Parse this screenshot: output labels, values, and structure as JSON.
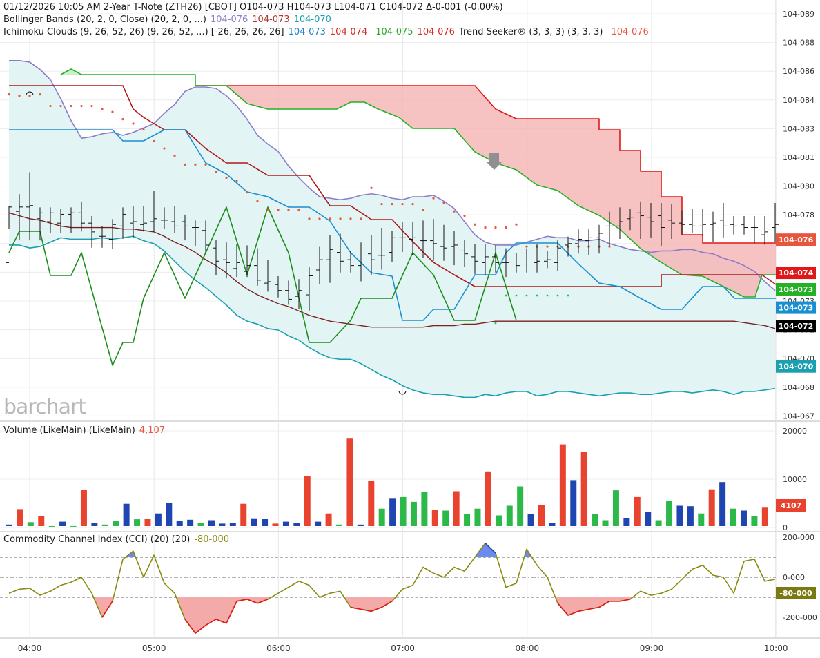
{
  "header": {
    "line1": "01/12/2026  10:05 AM  2-Year T-Note (ZTH26) [CBOT]  O104-073  H104-073  L104-071  C104-072  Δ-0-001  (-0.00%)",
    "bb_label": "Bollinger Bands (20, 2, 0, Close)  (20, 2, 0, ...)",
    "bb_upper": "104-076",
    "bb_mid": "104-073",
    "bb_lower": "104-070",
    "ichi_label": "Ichimoku Clouds (9, 26, 52, 26)  (9, 26, 52, ...)  [-26, 26, 26, 26]",
    "ichi_v1": "104-073",
    "ichi_v2": "104-074",
    "ichi_v3": "104-075",
    "ichi_v4": "104-076",
    "ts_label": "Trend Seeker® (3, 3, 3)  (3, 3, 3)",
    "ts_value": "104-076",
    "vol_label": "Volume (LikeMain)  (LikeMain)",
    "vol_value": "4,107",
    "cci_label": "Commodity Channel Index (CCI) (20)  (20)",
    "cci_value": "-80-000"
  },
  "logo": "barchart",
  "colors": {
    "up": "#2db84a",
    "down": "#e8432e",
    "neutral": "#1f46b0",
    "bb": "#8a7cc8",
    "bb_fill": "#e3f4f4",
    "cloud_bear": "#f5b3b3",
    "kijun": "#b01818",
    "tenkan": "#1a8fd0",
    "chikou": "#1a8f1a",
    "span_a": "#26b026",
    "span_b": "#e01818",
    "cci": "#8a8a10"
  },
  "chart_data": [
    {
      "type": "line",
      "title": "2-Year T-Note (ZTH26) [CBOT]",
      "y_ticks": [
        "104-089",
        "104-088",
        "104-086",
        "104-084",
        "104-083",
        "104-081",
        "104-080",
        "104-078",
        "104-077",
        "104-075",
        "104-073",
        "104-072",
        "104-070",
        "104-068",
        "104-067"
      ],
      "x_ticks": [
        "04:00",
        "05:00",
        "06:00",
        "07:00",
        "08:00",
        "09:00",
        "10:00"
      ],
      "x_range": [
        "03:45",
        "10:00"
      ],
      "price_levels": {
        "104-089": 0,
        "104-067": 22
      },
      "last_labels": [
        {
          "text": "104-076",
          "level": 12.3,
          "bg": "#e8553d"
        },
        {
          "text": "104-074",
          "level": 14.1,
          "bg": "#e01818"
        },
        {
          "text": "104-073",
          "level": 15.0,
          "bg": "#26b026"
        },
        {
          "text": "104-073",
          "level": 16.0,
          "bg": "#1a8fd0"
        },
        {
          "text": "104-072",
          "level": 17.0,
          "bg": "#000000"
        },
        {
          "text": "104-070",
          "level": 19.2,
          "bg": "#1aa0b0"
        }
      ],
      "bars": [
        [
          17.0,
          13.5,
          14.3,
          13.2
        ],
        [
          13.5,
          12.7,
          15.1,
          13.2
        ],
        [
          13.2,
          11.2,
          15.1,
          13.1
        ],
        [
          14.0,
          13.6,
          15.1,
          13.6
        ],
        [
          14.2,
          13.6,
          14.6,
          13.6
        ],
        [
          14.3,
          13.7,
          14.6,
          13.7
        ],
        [
          13.7,
          13.6,
          14.6,
          13.6
        ],
        [
          13.6,
          13.2,
          14.5,
          14.3
        ],
        [
          14.3,
          14.2,
          15.6,
          14.9
        ],
        [
          15.2,
          14.9,
          15.6,
          15.2
        ],
        [
          15.4,
          14.4,
          15.7,
          14.4
        ],
        [
          14.5,
          13.6,
          15.0,
          13.7
        ],
        [
          14.3,
          13.5,
          14.9,
          14.2
        ],
        [
          14.4,
          13.5,
          14.5,
          14.3
        ],
        [
          14.2,
          12.5,
          14.5,
          14.0
        ],
        [
          14.1,
          13.6,
          14.3,
          14.1
        ],
        [
          14.2,
          13.5,
          14.6,
          14.5
        ],
        [
          14.2,
          14.1,
          15.1,
          14.5
        ],
        [
          14.6,
          14.5,
          15.5,
          14.6
        ],
        [
          14.8,
          14.5,
          16.0,
          15.8
        ],
        [
          16.0,
          15.8,
          17.5,
          16.9
        ],
        [
          16.8,
          16.0,
          17.7,
          17.0
        ],
        [
          17.4,
          16.1,
          17.6,
          17.0
        ],
        [
          17.6,
          16.2,
          17.6,
          17.2
        ],
        [
          17.2,
          16.4,
          18.2,
          18.2
        ],
        [
          18.4,
          17.2,
          18.6,
          18.3
        ],
        [
          18.5,
          18.3,
          19.0,
          18.9
        ],
        [
          18.9,
          18.6,
          19.5,
          19.5
        ],
        [
          19.3,
          18.5,
          19.8,
          18.9
        ],
        [
          19.2,
          17.7,
          19.9,
          17.9
        ],
        [
          17.5,
          16.3,
          18.1,
          16.8
        ],
        [
          16.8,
          15.5,
          18.0,
          16.1
        ],
        [
          16.3,
          15.4,
          17.3,
          16.9
        ],
        [
          16.8,
          16.6,
          17.3,
          17.2
        ],
        [
          17.2,
          16.0,
          17.9,
          17.1
        ],
        [
          16.4,
          15.5,
          17.5,
          16.8
        ],
        [
          16.5,
          15.0,
          17.1,
          16.5
        ],
        [
          16.3,
          15.2,
          16.6,
          15.3
        ],
        [
          15.3,
          14.6,
          15.9,
          15.3
        ],
        [
          15.4,
          14.6,
          16.1,
          15.3
        ],
        [
          15.5,
          14.5,
          16.3,
          15.5
        ],
        [
          15.5,
          14.4,
          16.5,
          15.7
        ],
        [
          15.9,
          14.8,
          16.5,
          16.0
        ],
        [
          15.9,
          15.2,
          16.8,
          15.8
        ],
        [
          16.2,
          15.8,
          16.9,
          16.4
        ],
        [
          16.6,
          16.1,
          17.4,
          16.9
        ],
        [
          17.0,
          16.1,
          17.5,
          16.6
        ],
        [
          16.6,
          16.2,
          17.3,
          17.0
        ],
        [
          17.0,
          16.4,
          17.6,
          17.0
        ],
        [
          17.1,
          16.7,
          17.3,
          17.2
        ],
        [
          17.1,
          16.4,
          17.3,
          17.1
        ],
        [
          17.0,
          16.1,
          17.3,
          16.9
        ],
        [
          16.9,
          16.6,
          17.0,
          16.8
        ],
        [
          17.0,
          15.8,
          17.2,
          16.0
        ],
        [
          15.8,
          15.6,
          16.2,
          15.7
        ],
        [
          15.7,
          15.1,
          16.0,
          15.4
        ],
        [
          15.5,
          15.1,
          16.1,
          15.3
        ],
        [
          15.3,
          14.8,
          16.0,
          15.0
        ],
        [
          14.5,
          13.9,
          15.5,
          14.5
        ],
        [
          14.5,
          13.6,
          15.0,
          14.2
        ],
        [
          14.0,
          13.7,
          14.4,
          13.9
        ],
        [
          13.6,
          13.2,
          15.0,
          13.8
        ],
        [
          13.9,
          13.3,
          14.9,
          14.2
        ],
        [
          13.8,
          13.3,
          15.5,
          14.6
        ],
        [
          14.1,
          13.4,
          15.0,
          14.3
        ],
        [
          14.3,
          13.8,
          14.7,
          14.4
        ],
        [
          14.4,
          13.7,
          14.6,
          14.5
        ],
        [
          14.5,
          13.7,
          14.8,
          14.4
        ],
        [
          14.4,
          13.9,
          15.2,
          14.3
        ],
        [
          14.1,
          13.3,
          14.9,
          14.5
        ],
        [
          14.4,
          14.2,
          14.7,
          14.5
        ],
        [
          14.4,
          14.2,
          14.7,
          14.6
        ],
        [
          14.6,
          14.2,
          15.3,
          14.6
        ],
        [
          15.1,
          14.2,
          15.4,
          14.9
        ],
        [
          14.6,
          13.3,
          15.2,
          14.4
        ]
      ],
      "bb_upper": [
        3.2,
        3.2,
        3.3,
        3.8,
        4.5,
        5.8,
        7.3,
        8.5,
        8.4,
        8.2,
        8.1,
        8.3,
        8.1,
        7.8,
        7.5,
        6.8,
        6.2,
        5.3,
        5.0,
        5.0,
        5.1,
        5.6,
        6.3,
        7.2,
        8.3,
        8.9,
        9.4,
        10.4,
        11.2,
        11.9,
        12.5,
        12.6,
        12.7,
        12.6,
        12.4,
        12.3,
        12.4,
        12.6,
        12.7,
        12.5,
        12.5,
        12.4,
        12.8,
        13.3,
        14.2,
        15.1,
        15.6,
        15.8,
        15.8,
        15.8,
        15.6,
        15.4,
        15.2,
        15.3,
        15.3,
        15.5,
        15.5,
        15.4,
        15.7,
        15.9,
        16.1,
        16.2,
        16.3,
        16.2,
        16.2,
        16.1,
        16.1,
        16.3,
        16.4,
        16.7,
        16.9,
        17.2,
        17.6,
        18.3,
        18.9
      ],
      "bb_lower": [
        15.8,
        15.8,
        16.0,
        15.9,
        15.6,
        15.3,
        15.4,
        15.4,
        15.4,
        15.3,
        15.4,
        15.3,
        15.2,
        15.5,
        15.7,
        16.2,
        16.9,
        17.6,
        18.2,
        18.7,
        19.3,
        19.9,
        20.6,
        21.0,
        21.2,
        21.5,
        21.6,
        22.0,
        22.3,
        22.8,
        23.2,
        23.5,
        23.6,
        23.6,
        23.9,
        24.3,
        24.7,
        25.0,
        25.4,
        25.7,
        25.9,
        26.0,
        26.0,
        26.1,
        26.2,
        26.2,
        26.0,
        26.1,
        25.9,
        25.8,
        25.8,
        26.1,
        26.0,
        25.8,
        25.8,
        25.9,
        26.0,
        26.1,
        26.0,
        25.9,
        25.9,
        26.0,
        26.0,
        25.9,
        25.8,
        25.8,
        25.9,
        25.8,
        25.7,
        25.8,
        26.0,
        25.8,
        25.8,
        25.7,
        25.6
      ],
      "bb_mid": [
        13.6,
        13.8,
        14.0,
        14.1,
        14.3,
        14.5,
        14.6,
        14.6,
        14.6,
        14.6,
        14.6,
        14.7,
        14.7,
        14.8,
        14.9,
        15.2,
        15.6,
        15.9,
        16.3,
        16.8,
        17.2,
        17.7,
        18.3,
        18.8,
        19.2,
        19.5,
        19.8,
        20.0,
        20.3,
        20.6,
        20.8,
        21.0,
        21.1,
        21.2,
        21.3,
        21.4,
        21.4,
        21.4,
        21.4,
        21.4,
        21.4,
        21.3,
        21.3,
        21.3,
        21.2,
        21.2,
        21.1,
        21.0,
        21.0,
        21.0,
        21.0,
        21.0,
        21.0,
        21.0,
        21.0,
        21.0,
        21.0,
        21.0,
        21.0,
        21.0,
        21.0,
        21.0,
        21.0,
        21.0,
        21.0,
        21.0,
        21.0,
        21.0,
        21.0,
        21.0,
        21.0,
        21.1,
        21.2,
        21.3,
        21.5
      ],
      "ts_dots": [
        [
          0,
          5.5
        ],
        [
          1,
          5.6
        ],
        [
          2,
          5.6
        ],
        [
          3,
          5.5
        ],
        [
          4,
          6.3
        ],
        [
          5,
          6.3
        ],
        [
          6,
          6.3
        ],
        [
          7,
          6.3
        ],
        [
          8,
          6.3
        ],
        [
          9,
          6.5
        ],
        [
          10,
          6.7
        ],
        [
          11,
          7.2
        ],
        [
          12,
          7.5
        ],
        [
          13,
          7.9
        ],
        [
          14,
          8.7
        ],
        [
          15,
          9.2
        ],
        [
          16,
          9.7
        ],
        [
          17,
          10.3
        ],
        [
          18,
          10.3
        ],
        [
          19,
          10.3
        ],
        [
          20,
          10.8
        ],
        [
          21,
          11.2
        ],
        [
          22,
          11.4
        ],
        [
          23,
          12.2
        ],
        [
          24,
          12.8
        ],
        [
          25,
          13.4
        ],
        [
          26,
          13.4
        ],
        [
          27,
          13.4
        ],
        [
          28,
          13.4
        ],
        [
          29,
          14.0
        ],
        [
          30,
          14.0
        ],
        [
          31,
          14.0
        ],
        [
          32,
          14.0
        ],
        [
          33,
          14.0
        ],
        [
          34,
          14.0
        ],
        [
          35,
          11.9
        ],
        [
          36,
          13.0
        ],
        [
          37,
          13.0
        ],
        [
          38,
          13.0
        ],
        [
          39,
          13.0
        ],
        [
          40,
          13.4
        ],
        [
          41,
          12.6
        ],
        [
          42,
          12.9
        ],
        [
          43,
          13.5
        ],
        [
          44,
          13.8
        ],
        [
          45,
          14.4
        ],
        [
          46,
          14.6
        ],
        [
          47,
          14.6
        ],
        [
          48,
          14.6
        ],
        [
          49,
          14.4
        ],
        [
          50,
          15.9
        ],
        [
          51,
          15.9
        ],
        [
          52,
          15.9
        ],
        [
          53,
          15.9
        ],
        [
          54,
          15.9
        ],
        [
          55,
          15.9
        ],
        [
          56,
          15.9
        ],
        [
          57,
          15.9
        ],
        [
          58,
          15.9
        ]
      ],
      "vol_ticks": [
        "20000",
        "10000",
        "0"
      ],
      "vol_last": "4107",
      "volume": [
        [
          600,
          "n"
        ],
        [
          3800,
          "d"
        ],
        [
          1100,
          "u"
        ],
        [
          2300,
          "d"
        ],
        [
          300,
          "u"
        ],
        [
          1200,
          "n"
        ],
        [
          300,
          "u"
        ],
        [
          7800,
          "d"
        ],
        [
          900,
          "n"
        ],
        [
          600,
          "u"
        ],
        [
          1300,
          "u"
        ],
        [
          4900,
          "n"
        ],
        [
          1700,
          "u"
        ],
        [
          1800,
          "d"
        ],
        [
          2900,
          "n"
        ],
        [
          5100,
          "n"
        ],
        [
          1400,
          "n"
        ],
        [
          1600,
          "n"
        ],
        [
          1000,
          "u"
        ],
        [
          1500,
          "n"
        ],
        [
          800,
          "n"
        ],
        [
          900,
          "n"
        ],
        [
          4900,
          "d"
        ],
        [
          1900,
          "n"
        ],
        [
          1800,
          "n"
        ],
        [
          800,
          "d"
        ],
        [
          1200,
          "n"
        ],
        [
          900,
          "n"
        ],
        [
          10600,
          "d"
        ],
        [
          1200,
          "n"
        ],
        [
          2900,
          "d"
        ],
        [
          600,
          "u"
        ],
        [
          18400,
          "d"
        ],
        [
          600,
          "n"
        ],
        [
          9700,
          "d"
        ],
        [
          3900,
          "u"
        ],
        [
          6100,
          "n"
        ],
        [
          6300,
          "u"
        ],
        [
          5300,
          "u"
        ],
        [
          7300,
          "u"
        ],
        [
          3700,
          "d"
        ],
        [
          3500,
          "u"
        ],
        [
          7500,
          "d"
        ],
        [
          2800,
          "u"
        ],
        [
          3900,
          "u"
        ],
        [
          11600,
          "d"
        ],
        [
          2500,
          "u"
        ],
        [
          4500,
          "u"
        ],
        [
          8500,
          "u"
        ],
        [
          2800,
          "n"
        ],
        [
          4700,
          "d"
        ],
        [
          900,
          "n"
        ],
        [
          17200,
          "d"
        ],
        [
          9800,
          "n"
        ],
        [
          15600,
          "d"
        ],
        [
          2800,
          "u"
        ],
        [
          1500,
          "u"
        ],
        [
          7700,
          "u"
        ],
        [
          2000,
          "n"
        ],
        [
          6300,
          "d"
        ],
        [
          3200,
          "n"
        ],
        [
          1500,
          "u"
        ],
        [
          5500,
          "u"
        ],
        [
          4500,
          "n"
        ],
        [
          4400,
          "n"
        ],
        [
          2900,
          "u"
        ],
        [
          7900,
          "d"
        ],
        [
          9400,
          "n"
        ],
        [
          3900,
          "u"
        ],
        [
          3500,
          "n"
        ],
        [
          2400,
          "u"
        ],
        [
          4107,
          "d"
        ]
      ],
      "cci_ticks": [
        "200-000",
        "0-000",
        "-200-000"
      ],
      "cci": [
        -80,
        -60,
        -55,
        -90,
        -70,
        -40,
        -25,
        0,
        -80,
        -200,
        -120,
        90,
        130,
        0,
        110,
        -30,
        -80,
        -210,
        -280,
        -240,
        -210,
        -230,
        -120,
        -110,
        -130,
        -110,
        -80,
        -50,
        -20,
        -40,
        -100,
        -80,
        -70,
        -150,
        -160,
        -170,
        -150,
        -120,
        -60,
        -40,
        50,
        20,
        0,
        50,
        30,
        100,
        170,
        120,
        -50,
        -30,
        140,
        60,
        0,
        -130,
        -190,
        -170,
        -160,
        -150,
        -120,
        -120,
        -110,
        -70,
        -90,
        -80,
        -60,
        -10,
        40,
        60,
        10,
        0,
        -80,
        80,
        90,
        -20,
        -10
      ]
    }
  ]
}
